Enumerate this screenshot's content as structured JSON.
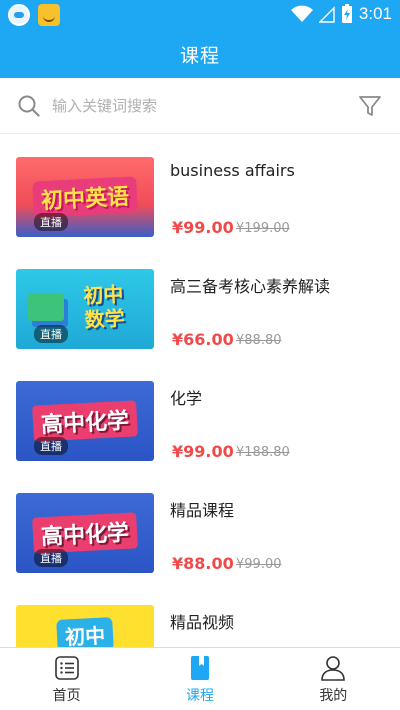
{
  "status_bar": {
    "time": "3:01",
    "icons": [
      "wifi-icon",
      "signal-icon",
      "battery-charging-icon"
    ]
  },
  "header": {
    "title": "课程"
  },
  "search": {
    "placeholder": "输入关键词搜索",
    "value": ""
  },
  "courses": [
    {
      "thumb_title": "初中英语",
      "badge": "直播",
      "name": "business affairs",
      "price": "¥99.00",
      "original_price": "¥199.00"
    },
    {
      "thumb_title": "初中数学",
      "badge": "直播",
      "name": "高三备考核心素养解读",
      "price": "¥66.00",
      "original_price": "¥88.80"
    },
    {
      "thumb_title": "高中化学",
      "badge": "直播",
      "name": "化学",
      "price": "¥99.00",
      "original_price": "¥188.80"
    },
    {
      "thumb_title": "高中化学",
      "badge": "直播",
      "name": "精品课程",
      "price": "¥88.00",
      "original_price": "¥99.00"
    },
    {
      "thumb_title": "初中",
      "badge": "",
      "name": "精品视频",
      "price": "",
      "original_price": ""
    }
  ],
  "colors": {
    "brand": "#1ea7f2",
    "price": "#f04a4a"
  },
  "nav": [
    {
      "label": "首页",
      "icon": "home-list-icon",
      "active": false
    },
    {
      "label": "课程",
      "icon": "course-book-icon",
      "active": true
    },
    {
      "label": "我的",
      "icon": "profile-icon",
      "active": false
    }
  ]
}
